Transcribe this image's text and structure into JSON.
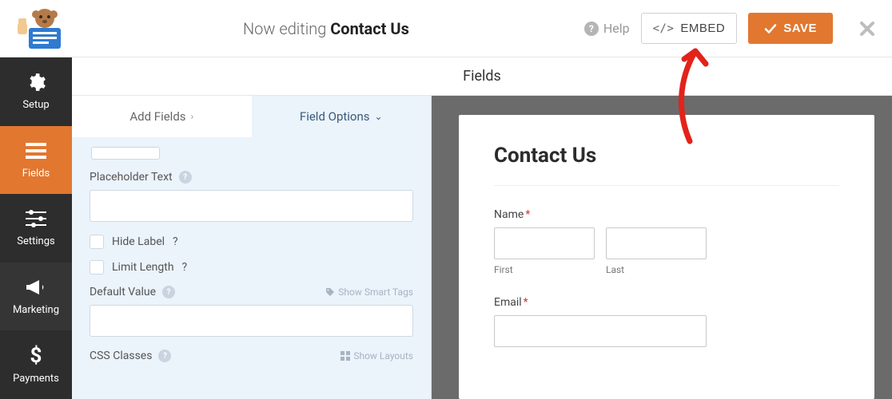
{
  "topbar": {
    "editing_prefix": "Now editing ",
    "editing_name": "Contact Us",
    "help_label": "Help",
    "embed_label": "EMBED",
    "save_label": "SAVE"
  },
  "sidebar": {
    "items": [
      {
        "id": "setup",
        "label": "Setup",
        "icon": "gear"
      },
      {
        "id": "fields",
        "label": "Fields",
        "icon": "list"
      },
      {
        "id": "settings",
        "label": "Settings",
        "icon": "sliders"
      },
      {
        "id": "marketing",
        "label": "Marketing",
        "icon": "megaphone"
      },
      {
        "id": "payments",
        "label": "Payments",
        "icon": "dollar"
      }
    ],
    "active": "fields"
  },
  "center": {
    "header": "Fields",
    "tabs": {
      "add_fields": "Add Fields",
      "field_options": "Field Options"
    },
    "active_tab": "field_options"
  },
  "options": {
    "placeholder_label": "Placeholder Text",
    "placeholder_value": "",
    "hide_label": "Hide Label",
    "limit_length": "Limit Length",
    "default_value_label": "Default Value",
    "default_value_value": "",
    "show_smart_tags": "Show Smart Tags",
    "css_classes_label": "CSS Classes",
    "show_layouts": "Show Layouts"
  },
  "preview": {
    "title": "Contact Us",
    "name_label": "Name",
    "first_label": "First",
    "last_label": "Last",
    "email_label": "Email",
    "required_marker": "*"
  },
  "colors": {
    "accent": "#e27730",
    "panel_blue": "#ebf3fb",
    "sidebar_bg": "#2d2d2d"
  }
}
